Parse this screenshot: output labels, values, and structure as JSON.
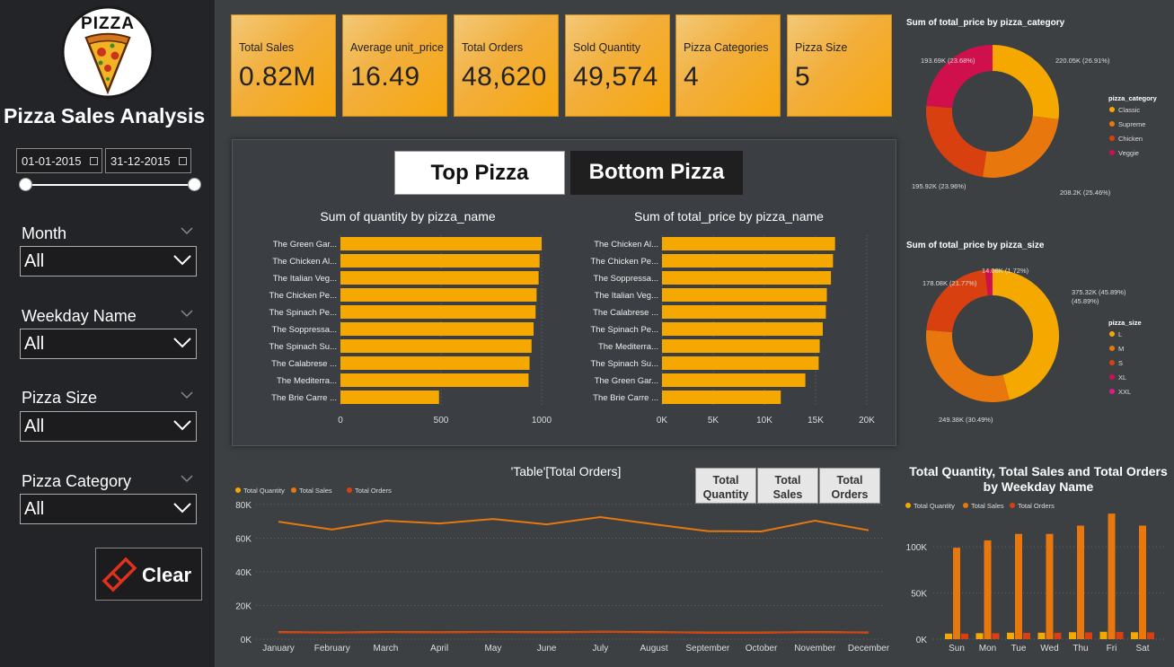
{
  "sidebar": {
    "logo_text": "PIZZA",
    "title": "Pizza Sales Analysis",
    "date_start": "01-01-2015",
    "date_end": "31-12-2015",
    "filters": [
      {
        "label": "Month",
        "value": "All"
      },
      {
        "label": "Weekday Name",
        "value": "All"
      },
      {
        "label": "Pizza Size",
        "value": "All"
      },
      {
        "label": "Pizza Category",
        "value": "All"
      }
    ],
    "clear_label": "Clear"
  },
  "kpis": [
    {
      "label": "Total Sales",
      "value": "0.82M"
    },
    {
      "label": "Average unit_price",
      "value": "16.49"
    },
    {
      "label": "Total Orders",
      "value": "48,620"
    },
    {
      "label": "Sold Quantity",
      "value": "49,574"
    },
    {
      "label": "Pizza Categories",
      "value": "4"
    },
    {
      "label": "Pizza Size",
      "value": "5"
    }
  ],
  "toggle": {
    "top_label": "Top Pizza",
    "bottom_label": "Bottom Pizza",
    "active": "Top Pizza"
  },
  "line_buttons": [
    {
      "line1": "Total",
      "line2": "Quantity"
    },
    {
      "line1": "Total",
      "line2": "Sales"
    },
    {
      "line1": "Total",
      "line2": "Orders"
    }
  ],
  "colors": {
    "accent": "#f5a800",
    "orange": "#e8780e",
    "red": "#d9400f",
    "crimson": "#d0104c",
    "pink": "#e3198b"
  },
  "chart_data": [
    {
      "type": "bar",
      "orientation": "horizontal",
      "title": "Sum of quantity by pizza_name",
      "categories": [
        "The Green Gar...",
        "The Chicken Al...",
        "The Italian Veg...",
        "The Chicken Pe...",
        "The Spinach Pe...",
        "The Soppressa...",
        "The Spinach Su...",
        "The Calabrese ...",
        "The Mediterra...",
        "The Brie Carre ..."
      ],
      "values": [
        1000,
        990,
        985,
        975,
        970,
        960,
        950,
        940,
        935,
        490
      ],
      "xlim": [
        0,
        1000
      ],
      "xticks": [
        "0",
        "500",
        "1000"
      ]
    },
    {
      "type": "bar",
      "orientation": "horizontal",
      "title": "Sum of total_price by pizza_name",
      "categories": [
        "The Chicken Al...",
        "The Chicken Pe...",
        "The Soppressa...",
        "The Italian Veg...",
        "The Calabrese ...",
        "The Spinach Pe...",
        "The Mediterra...",
        "The Spinach Su...",
        "The Green Gar...",
        "The Brie Carre ..."
      ],
      "values": [
        16900,
        16700,
        16500,
        16100,
        16000,
        15700,
        15400,
        15300,
        14000,
        11600
      ],
      "xlim": [
        0,
        20000
      ],
      "xticks": [
        "0K",
        "5K",
        "10K",
        "15K",
        "20K"
      ]
    },
    {
      "type": "pie",
      "donut": true,
      "title": "Sum of total_price by pizza_category",
      "legend_title": "pizza_category",
      "labels": [
        "Classic",
        "Supreme",
        "Chicken",
        "Veggie"
      ],
      "values": [
        220.05,
        208.2,
        195.92,
        193.69
      ],
      "value_labels": [
        "220.05K (26.91%)",
        "208.2K (25.46%)",
        "195.92K (23.96%)",
        "193.69K (23.68%)"
      ],
      "colors": [
        "#f5a800",
        "#e8780e",
        "#d9400f",
        "#d0104c"
      ]
    },
    {
      "type": "pie",
      "donut": true,
      "title": "Sum of total_price by pizza_size",
      "legend_title": "pizza_size",
      "labels": [
        "L",
        "M",
        "S",
        "XL",
        "XXL"
      ],
      "values": [
        375.32,
        249.38,
        178.08,
        14.08,
        1.0
      ],
      "value_labels": [
        "375.32K (45.89%)",
        "249.38K (30.49%)",
        "178.08K (21.77%)",
        "14.08K (1.72%)"
      ],
      "colors": [
        "#f5a800",
        "#e8780e",
        "#d9400f",
        "#d0104c",
        "#e3198b"
      ]
    },
    {
      "type": "line",
      "title": "'Table'[Total Orders]",
      "legend": [
        "Total Quantity",
        "Total Sales",
        "Total Orders"
      ],
      "categories": [
        "January",
        "February",
        "March",
        "April",
        "May",
        "June",
        "July",
        "August",
        "September",
        "October",
        "November",
        "December"
      ],
      "series": [
        {
          "name": "Total Quantity",
          "values": [
            4232,
            3961,
            4261,
            4151,
            4328,
            4107,
            4392,
            4168,
            3890,
            3883,
            4266,
            3935
          ]
        },
        {
          "name": "Total Sales",
          "values": [
            69793,
            65160,
            70397,
            68737,
            71402,
            68230,
            72558,
            68278,
            64180,
            64028,
            70395,
            64701
          ]
        },
        {
          "name": "Total Orders",
          "values": [
            4156,
            3892,
            4186,
            4067,
            4239,
            4025,
            4301,
            4094,
            3819,
            3797,
            4185,
            3859
          ]
        }
      ],
      "ylim": [
        0,
        80000
      ],
      "yticks": [
        "0K",
        "20K",
        "40K",
        "60K",
        "80K"
      ]
    },
    {
      "type": "bar",
      "title": "Total Quantity, Total Sales and Total Orders by Weekday Name",
      "legend": [
        "Total Quantity",
        "Total Sales",
        "Total Orders"
      ],
      "categories": [
        "Sun",
        "Mon",
        "Tue",
        "Wed",
        "Thu",
        "Fri",
        "Sat"
      ],
      "series": [
        {
          "name": "Total Quantity",
          "values": [
            6000,
            6500,
            7000,
            7000,
            7500,
            8000,
            7500
          ]
        },
        {
          "name": "Total Sales",
          "values": [
            99000,
            107000,
            114000,
            114000,
            123000,
            136000,
            123000
          ]
        },
        {
          "name": "Total Orders",
          "values": [
            6000,
            6400,
            6800,
            6900,
            7300,
            7900,
            7300
          ]
        }
      ],
      "ylim": [
        0,
        140000
      ],
      "yticks": [
        "0K",
        "50K",
        "100K"
      ]
    }
  ]
}
